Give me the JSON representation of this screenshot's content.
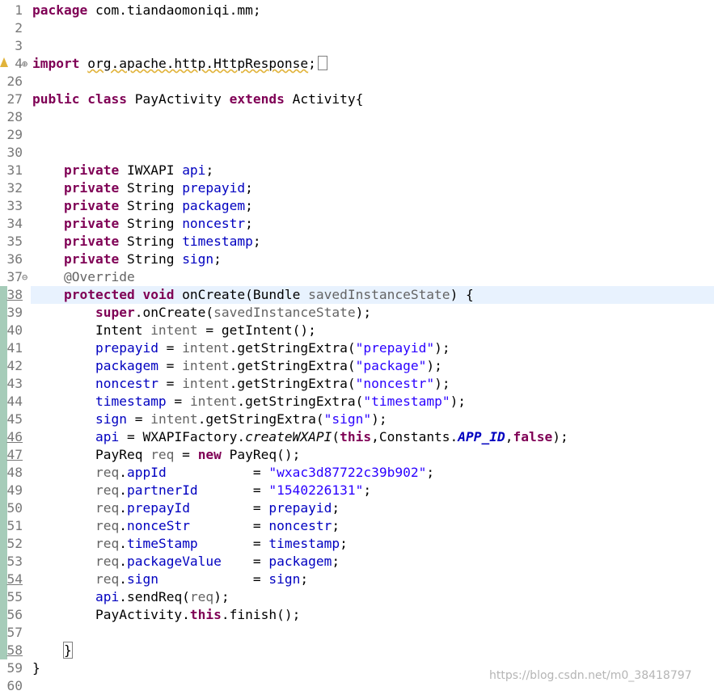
{
  "editor": {
    "watermark": "https://blog.csdn.net/m0_38418797",
    "lines": [
      {
        "num": "1",
        "tokens": [
          {
            "t": "package",
            "c": "kw"
          },
          {
            "t": " com.tiandaomoniqi.mm;"
          }
        ]
      },
      {
        "num": "2",
        "tokens": []
      },
      {
        "num": "3",
        "tokens": []
      },
      {
        "num": "4",
        "warn": true,
        "fold": "⊕",
        "tokens": [
          {
            "t": "import",
            "c": "kw"
          },
          {
            "t": " "
          },
          {
            "t": "org.apache.http.HttpResponse",
            "c": "warnul"
          },
          {
            "t": ";"
          }
        ],
        "box": true
      },
      {
        "num": "26",
        "tokens": []
      },
      {
        "num": "27",
        "tokens": [
          {
            "t": "public",
            "c": "kw"
          },
          {
            "t": " "
          },
          {
            "t": "class",
            "c": "kw"
          },
          {
            "t": " PayActivity "
          },
          {
            "t": "extends",
            "c": "kw"
          },
          {
            "t": " Activity{"
          }
        ]
      },
      {
        "num": "28",
        "tokens": []
      },
      {
        "num": "29",
        "tokens": []
      },
      {
        "num": "30",
        "tokens": []
      },
      {
        "num": "31",
        "tokens": [
          {
            "t": "    "
          },
          {
            "t": "private",
            "c": "kw"
          },
          {
            "t": " IWXAPI "
          },
          {
            "t": "api",
            "c": "field"
          },
          {
            "t": ";"
          }
        ]
      },
      {
        "num": "32",
        "tokens": [
          {
            "t": "    "
          },
          {
            "t": "private",
            "c": "kw"
          },
          {
            "t": " String "
          },
          {
            "t": "prepayid",
            "c": "field"
          },
          {
            "t": ";"
          }
        ]
      },
      {
        "num": "33",
        "tokens": [
          {
            "t": "    "
          },
          {
            "t": "private",
            "c": "kw"
          },
          {
            "t": " String "
          },
          {
            "t": "packagem",
            "c": "field"
          },
          {
            "t": ";"
          }
        ]
      },
      {
        "num": "34",
        "tokens": [
          {
            "t": "    "
          },
          {
            "t": "private",
            "c": "kw"
          },
          {
            "t": " String "
          },
          {
            "t": "noncestr",
            "c": "field"
          },
          {
            "t": ";"
          }
        ]
      },
      {
        "num": "35",
        "tokens": [
          {
            "t": "    "
          },
          {
            "t": "private",
            "c": "kw"
          },
          {
            "t": " String "
          },
          {
            "t": "timestamp",
            "c": "field"
          },
          {
            "t": ";"
          }
        ]
      },
      {
        "num": "36",
        "tokens": [
          {
            "t": "    "
          },
          {
            "t": "private",
            "c": "kw"
          },
          {
            "t": " String "
          },
          {
            "t": "sign",
            "c": "field"
          },
          {
            "t": ";"
          }
        ]
      },
      {
        "num": "37",
        "fold": "⊖",
        "tokens": [
          {
            "t": "    "
          },
          {
            "t": "@Override",
            "c": "ann"
          }
        ]
      },
      {
        "num": "38",
        "current": true,
        "changed": true,
        "ul": true,
        "tokens": [
          {
            "t": "    "
          },
          {
            "t": "protected",
            "c": "kw"
          },
          {
            "t": " "
          },
          {
            "t": "void",
            "c": "kw"
          },
          {
            "t": " onCreate(Bundle "
          },
          {
            "t": "savedInstanceState",
            "c": "ann"
          },
          {
            "t": ") {"
          }
        ]
      },
      {
        "num": "39",
        "changed": true,
        "tokens": [
          {
            "t": "        "
          },
          {
            "t": "super",
            "c": "kw"
          },
          {
            "t": ".onCreate("
          },
          {
            "t": "savedInstanceState",
            "c": "ann"
          },
          {
            "t": ");"
          }
        ]
      },
      {
        "num": "40",
        "changed": true,
        "tokens": [
          {
            "t": "        Intent "
          },
          {
            "t": "intent",
            "c": "ann"
          },
          {
            "t": " = getIntent();"
          }
        ]
      },
      {
        "num": "41",
        "changed": true,
        "tokens": [
          {
            "t": "        "
          },
          {
            "t": "prepayid",
            "c": "field"
          },
          {
            "t": " = "
          },
          {
            "t": "intent",
            "c": "ann"
          },
          {
            "t": ".getStringExtra("
          },
          {
            "t": "\"prepayid\"",
            "c": "str"
          },
          {
            "t": ");"
          }
        ]
      },
      {
        "num": "42",
        "changed": true,
        "tokens": [
          {
            "t": "        "
          },
          {
            "t": "packagem",
            "c": "field"
          },
          {
            "t": " = "
          },
          {
            "t": "intent",
            "c": "ann"
          },
          {
            "t": ".getStringExtra("
          },
          {
            "t": "\"package\"",
            "c": "str"
          },
          {
            "t": ");"
          }
        ]
      },
      {
        "num": "43",
        "changed": true,
        "tokens": [
          {
            "t": "        "
          },
          {
            "t": "noncestr",
            "c": "field"
          },
          {
            "t": " = "
          },
          {
            "t": "intent",
            "c": "ann"
          },
          {
            "t": ".getStringExtra("
          },
          {
            "t": "\"noncestr\"",
            "c": "str"
          },
          {
            "t": ");"
          }
        ]
      },
      {
        "num": "44",
        "changed": true,
        "tokens": [
          {
            "t": "        "
          },
          {
            "t": "timestamp",
            "c": "field"
          },
          {
            "t": " = "
          },
          {
            "t": "intent",
            "c": "ann"
          },
          {
            "t": ".getStringExtra("
          },
          {
            "t": "\"timestamp\"",
            "c": "str"
          },
          {
            "t": ");"
          }
        ]
      },
      {
        "num": "45",
        "changed": true,
        "tokens": [
          {
            "t": "        "
          },
          {
            "t": "sign",
            "c": "field"
          },
          {
            "t": " = "
          },
          {
            "t": "intent",
            "c": "ann"
          },
          {
            "t": ".getStringExtra("
          },
          {
            "t": "\"sign\"",
            "c": "str"
          },
          {
            "t": ");"
          }
        ]
      },
      {
        "num": "46",
        "changed": true,
        "ul": true,
        "tokens": [
          {
            "t": "        "
          },
          {
            "t": "api",
            "c": "field"
          },
          {
            "t": " = WXAPIFactory."
          },
          {
            "t": "createWXAPI",
            "c": "mstatic"
          },
          {
            "t": "("
          },
          {
            "t": "this",
            "c": "kw"
          },
          {
            "t": ",Constants."
          },
          {
            "t": "APP_ID",
            "c": "static"
          },
          {
            "t": ","
          },
          {
            "t": "false",
            "c": "kw"
          },
          {
            "t": ");"
          }
        ]
      },
      {
        "num": "47",
        "changed": true,
        "ul": true,
        "tokens": [
          {
            "t": "        PayReq "
          },
          {
            "t": "req",
            "c": "ann"
          },
          {
            "t": " = "
          },
          {
            "t": "new",
            "c": "kw"
          },
          {
            "t": " PayReq();"
          }
        ]
      },
      {
        "num": "48",
        "changed": true,
        "tokens": [
          {
            "t": "        "
          },
          {
            "t": "req",
            "c": "ann"
          },
          {
            "t": "."
          },
          {
            "t": "appId",
            "c": "field"
          },
          {
            "t": "           = "
          },
          {
            "t": "\"wxac3d87722c39b902\"",
            "c": "str"
          },
          {
            "t": ";"
          }
        ]
      },
      {
        "num": "49",
        "changed": true,
        "tokens": [
          {
            "t": "        "
          },
          {
            "t": "req",
            "c": "ann"
          },
          {
            "t": "."
          },
          {
            "t": "partnerId",
            "c": "field"
          },
          {
            "t": "       = "
          },
          {
            "t": "\"1540226131\"",
            "c": "str"
          },
          {
            "t": ";"
          }
        ]
      },
      {
        "num": "50",
        "changed": true,
        "tokens": [
          {
            "t": "        "
          },
          {
            "t": "req",
            "c": "ann"
          },
          {
            "t": "."
          },
          {
            "t": "prepayId",
            "c": "field"
          },
          {
            "t": "        = "
          },
          {
            "t": "prepayid",
            "c": "field"
          },
          {
            "t": ";"
          }
        ]
      },
      {
        "num": "51",
        "changed": true,
        "tokens": [
          {
            "t": "        "
          },
          {
            "t": "req",
            "c": "ann"
          },
          {
            "t": "."
          },
          {
            "t": "nonceStr",
            "c": "field"
          },
          {
            "t": "        = "
          },
          {
            "t": "noncestr",
            "c": "field"
          },
          {
            "t": ";"
          }
        ]
      },
      {
        "num": "52",
        "changed": true,
        "tokens": [
          {
            "t": "        "
          },
          {
            "t": "req",
            "c": "ann"
          },
          {
            "t": "."
          },
          {
            "t": "timeStamp",
            "c": "field"
          },
          {
            "t": "       = "
          },
          {
            "t": "timestamp",
            "c": "field"
          },
          {
            "t": ";"
          }
        ]
      },
      {
        "num": "53",
        "changed": true,
        "tokens": [
          {
            "t": "        "
          },
          {
            "t": "req",
            "c": "ann"
          },
          {
            "t": "."
          },
          {
            "t": "packageValue",
            "c": "field"
          },
          {
            "t": "    = "
          },
          {
            "t": "packagem",
            "c": "field"
          },
          {
            "t": ";"
          }
        ]
      },
      {
        "num": "54",
        "changed": true,
        "ul": true,
        "tokens": [
          {
            "t": "        "
          },
          {
            "t": "req",
            "c": "ann"
          },
          {
            "t": "."
          },
          {
            "t": "sign",
            "c": "field"
          },
          {
            "t": "            = "
          },
          {
            "t": "sign",
            "c": "field"
          },
          {
            "t": ";"
          }
        ]
      },
      {
        "num": "55",
        "changed": true,
        "tokens": [
          {
            "t": "        "
          },
          {
            "t": "api",
            "c": "field"
          },
          {
            "t": ".sendReq("
          },
          {
            "t": "req",
            "c": "ann"
          },
          {
            "t": ");"
          }
        ]
      },
      {
        "num": "56",
        "changed": true,
        "tokens": [
          {
            "t": "        PayActivity."
          },
          {
            "t": "this",
            "c": "kw"
          },
          {
            "t": ".finish();"
          }
        ]
      },
      {
        "num": "57",
        "changed": true,
        "tokens": []
      },
      {
        "num": "58",
        "changed": true,
        "ul": true,
        "tokens": [
          {
            "t": "    "
          },
          {
            "t": "}",
            "c": "brace"
          }
        ]
      },
      {
        "num": "59",
        "tokens": [
          {
            "t": "}"
          }
        ]
      },
      {
        "num": "60",
        "tokens": []
      }
    ]
  }
}
